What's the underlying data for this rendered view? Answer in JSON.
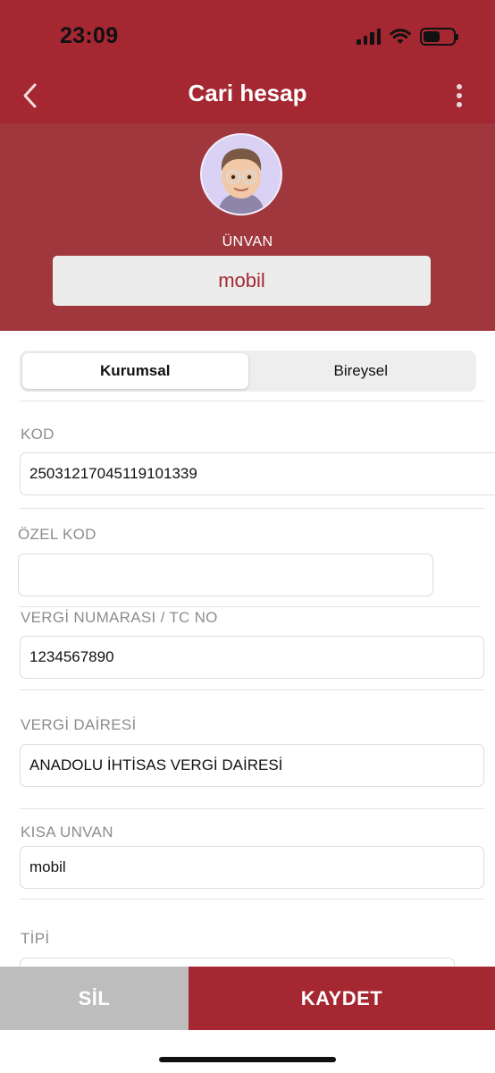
{
  "status_bar": {
    "time": "23:09",
    "icons": [
      "cellular-signal-icon",
      "wifi-icon",
      "battery-icon"
    ]
  },
  "nav": {
    "back_icon": "chevron-left-icon",
    "title": "Cari hesap",
    "more_icon": "more-vertical-icon"
  },
  "profile": {
    "avatar_icon": "memoji-avatar",
    "unvan_label": "ÜNVAN",
    "unvan_value": "mobil"
  },
  "segment": {
    "options": [
      "Kurumsal",
      "Bireysel"
    ],
    "selected": "Kurumsal"
  },
  "form": {
    "kod": {
      "label": "KOD",
      "value": "25031217045119101339"
    },
    "ozel_kod": {
      "label": "ÖZEL KOD",
      "value": ""
    },
    "vergi_no": {
      "label": "VERGİ NUMARASI / TC NO",
      "value": "1234567890"
    },
    "vergi_dairesi": {
      "label": "VERGİ DAİRESİ",
      "value": "ANADOLU İHTİSAS VERGİ DAİRESİ"
    },
    "kisa_unvan": {
      "label": "KISA UNVAN",
      "value": "mobil"
    },
    "tipi": {
      "label": "TİPİ",
      "value": ""
    }
  },
  "actions": {
    "delete_label": "SİL",
    "save_label": "KAYDET"
  },
  "colors": {
    "primary": "#a52732",
    "header_bg": "#a0373c",
    "delete_bg": "#bdbdbd",
    "label_gray": "#8d8d8d"
  }
}
